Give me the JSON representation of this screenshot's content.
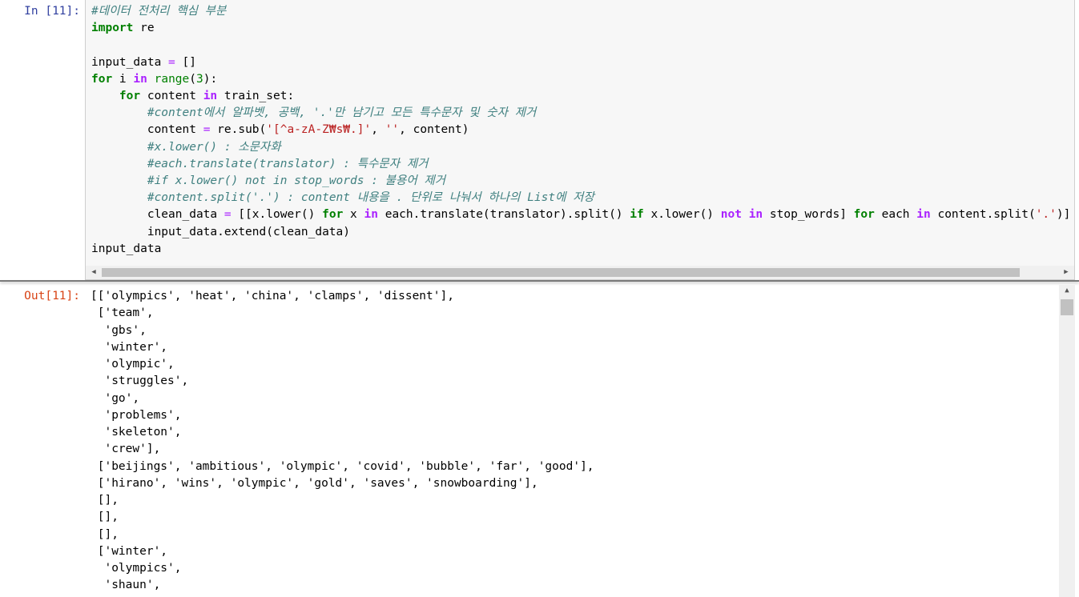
{
  "cell": {
    "in_prompt": "In [11]:",
    "out_prompt": "Out[11]:",
    "code_lines": [
      "#데이터 전처리 핵심 부분",
      "import re",
      "",
      "input_data = []",
      "for i in range(3):",
      "    for content in train_set:",
      "        #content에서 알파벳, 공백, '.'만 남기고 모든 특수문자 및 숫자 제거",
      "        content = re.sub('[^a-zA-Z₩s₩.]', '', content)",
      "        #x.lower() : 소문자화",
      "        #each.translate(translator) : 특수문자 제거",
      "        #if x.lower() not in stop_words : 불용어 제거",
      "        #content.split('.') : content 내용을 . 단위로 나눠서 하나의 List에 저장",
      "        clean_data = [[x.lower() for x in each.translate(translator).split() if x.lower() not in stop_words] for each in content.split('.')]",
      "        input_data.extend(clean_data)",
      "input_data"
    ],
    "output_lines": [
      "[['olympics', 'heat', 'china', 'clamps', 'dissent'],",
      " ['team',",
      "  'gbs',",
      "  'winter',",
      "  'olympic',",
      "  'struggles',",
      "  'go',",
      "  'problems',",
      "  'skeleton',",
      "  'crew'],",
      " ['beijings', 'ambitious', 'olympic', 'covid', 'bubble', 'far', 'good'],",
      " ['hirano', 'wins', 'olympic', 'gold', 'saves', 'snowboarding'],",
      " [],",
      " [],",
      " [],",
      " ['winter',",
      "  'olympics',",
      "  'shaun',"
    ]
  },
  "scrollbar": {
    "left_arrow": "◀",
    "right_arrow": "▶",
    "up_arrow": "▲"
  }
}
